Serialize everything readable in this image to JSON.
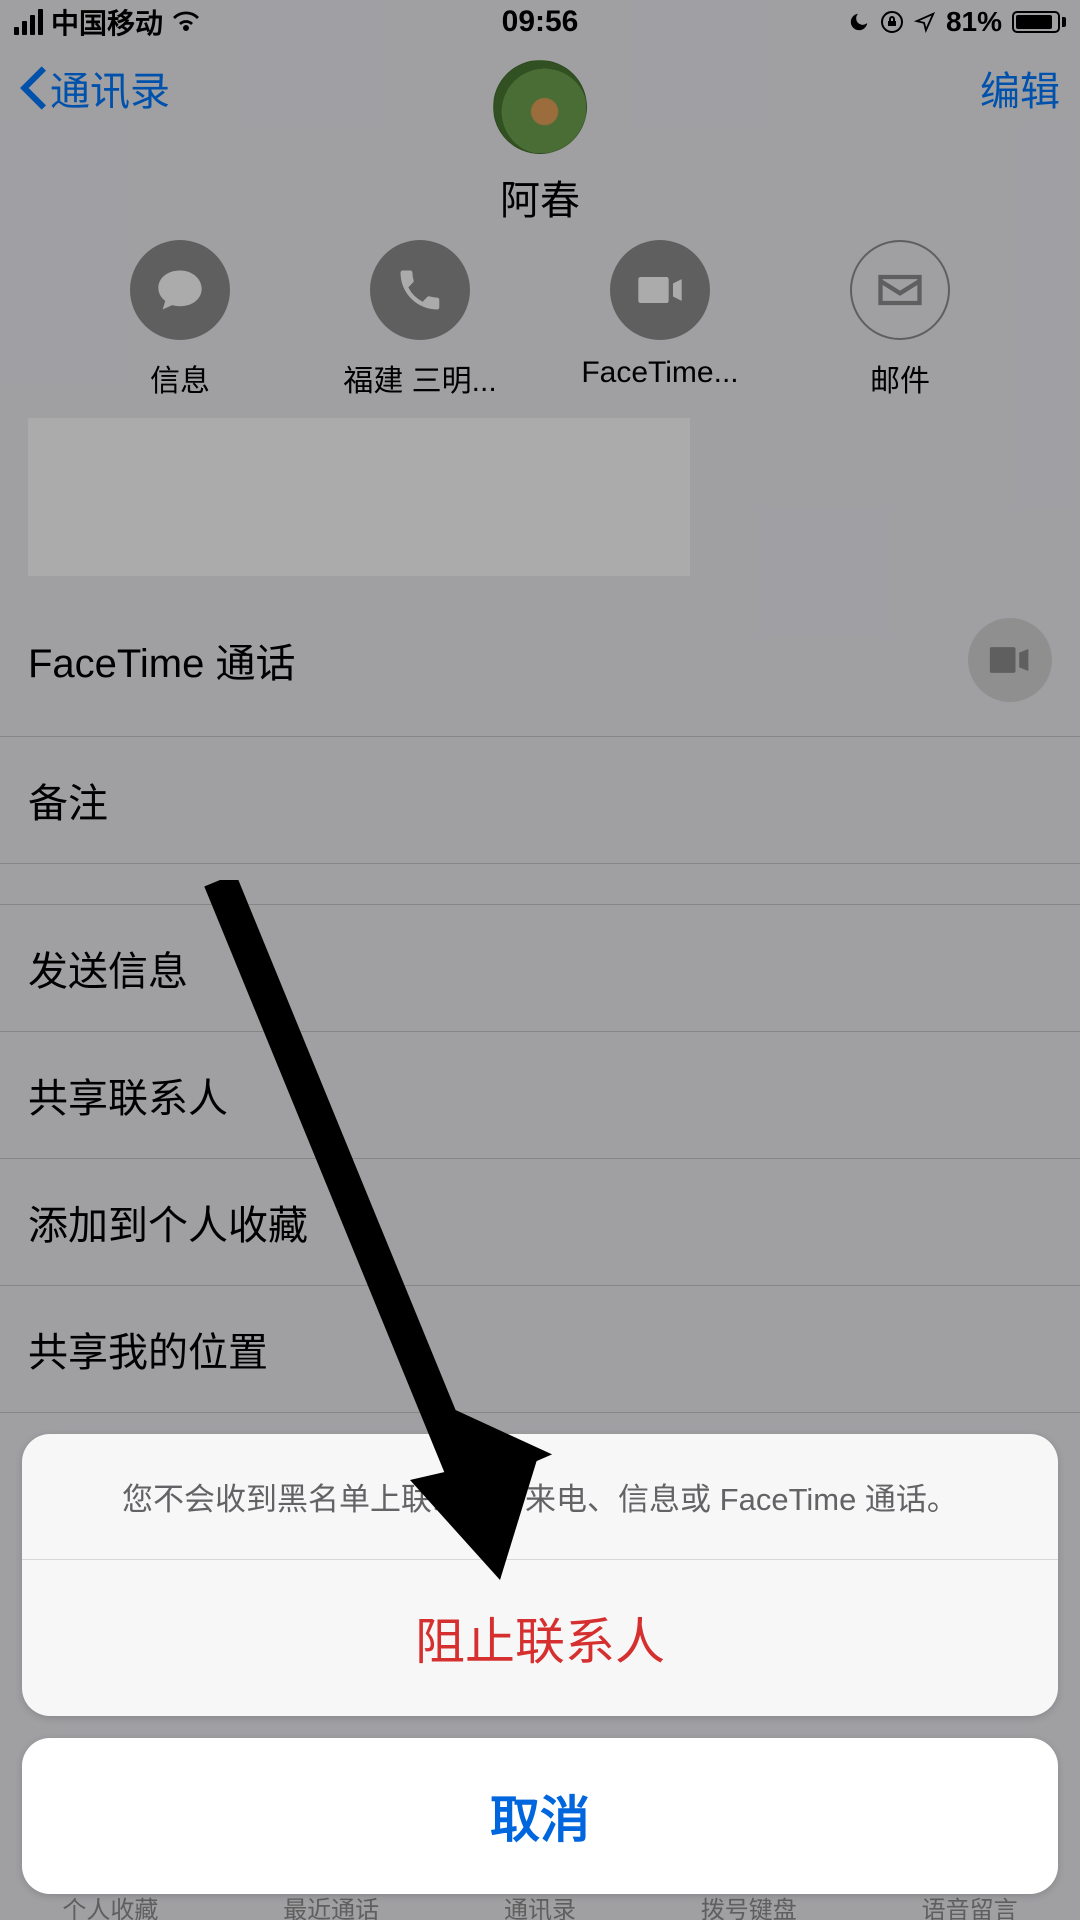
{
  "status": {
    "carrier": "中国移动",
    "time": "09:56",
    "battery_pct": "81%"
  },
  "nav": {
    "back_label": "通讯录",
    "edit_label": "编辑"
  },
  "contact": {
    "name": "阿春"
  },
  "actions": {
    "message": "信息",
    "call": "福建 三明...",
    "facetime": "FaceTime...",
    "mail": "邮件"
  },
  "rows": {
    "facetime_call": "FaceTime 通话",
    "notes": "备注",
    "send_message": "发送信息",
    "share_contact": "共享联系人",
    "add_favorite": "添加到个人收藏",
    "share_location": "共享我的位置"
  },
  "sheet": {
    "message": "您不会收到黑名单上联系人的来电、信息或 FaceTime 通话。",
    "block": "阻止联系人",
    "cancel": "取消"
  },
  "tabs": {
    "t1": "个人收藏",
    "t2": "最近通话",
    "t3": "通讯录",
    "t4": "拨号键盘",
    "t5": "语音留言"
  }
}
